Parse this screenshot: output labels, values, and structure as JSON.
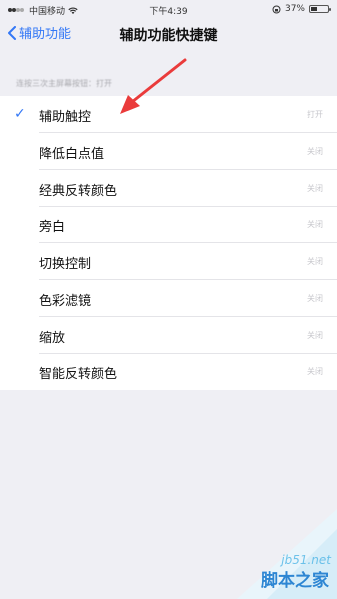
{
  "status_bar": {
    "carrier": "中国移动",
    "time": "下午4:39",
    "battery_percent": "37%",
    "battery_level": 0.37
  },
  "nav": {
    "back_label": "辅助功能",
    "title": "辅助功能快捷键"
  },
  "section_header": "连按三次主屏幕按钮：打开",
  "rows": [
    {
      "label": "辅助触控",
      "checked": true,
      "state": "打开"
    },
    {
      "label": "降低白点值",
      "checked": false,
      "state": "关闭"
    },
    {
      "label": "经典反转颜色",
      "checked": false,
      "state": "关闭"
    },
    {
      "label": "旁白",
      "checked": false,
      "state": "关闭"
    },
    {
      "label": "切换控制",
      "checked": false,
      "state": "关闭"
    },
    {
      "label": "色彩滤镜",
      "checked": false,
      "state": "关闭"
    },
    {
      "label": "缩放",
      "checked": false,
      "state": "关闭"
    },
    {
      "label": "智能反转颜色",
      "checked": false,
      "state": "关闭"
    }
  ],
  "watermark": {
    "site": "jb51.net",
    "name": "脚本之家"
  },
  "colors": {
    "accent": "#3478f6",
    "annotation_arrow": "#ea3b3b",
    "background": "#efeff4"
  }
}
